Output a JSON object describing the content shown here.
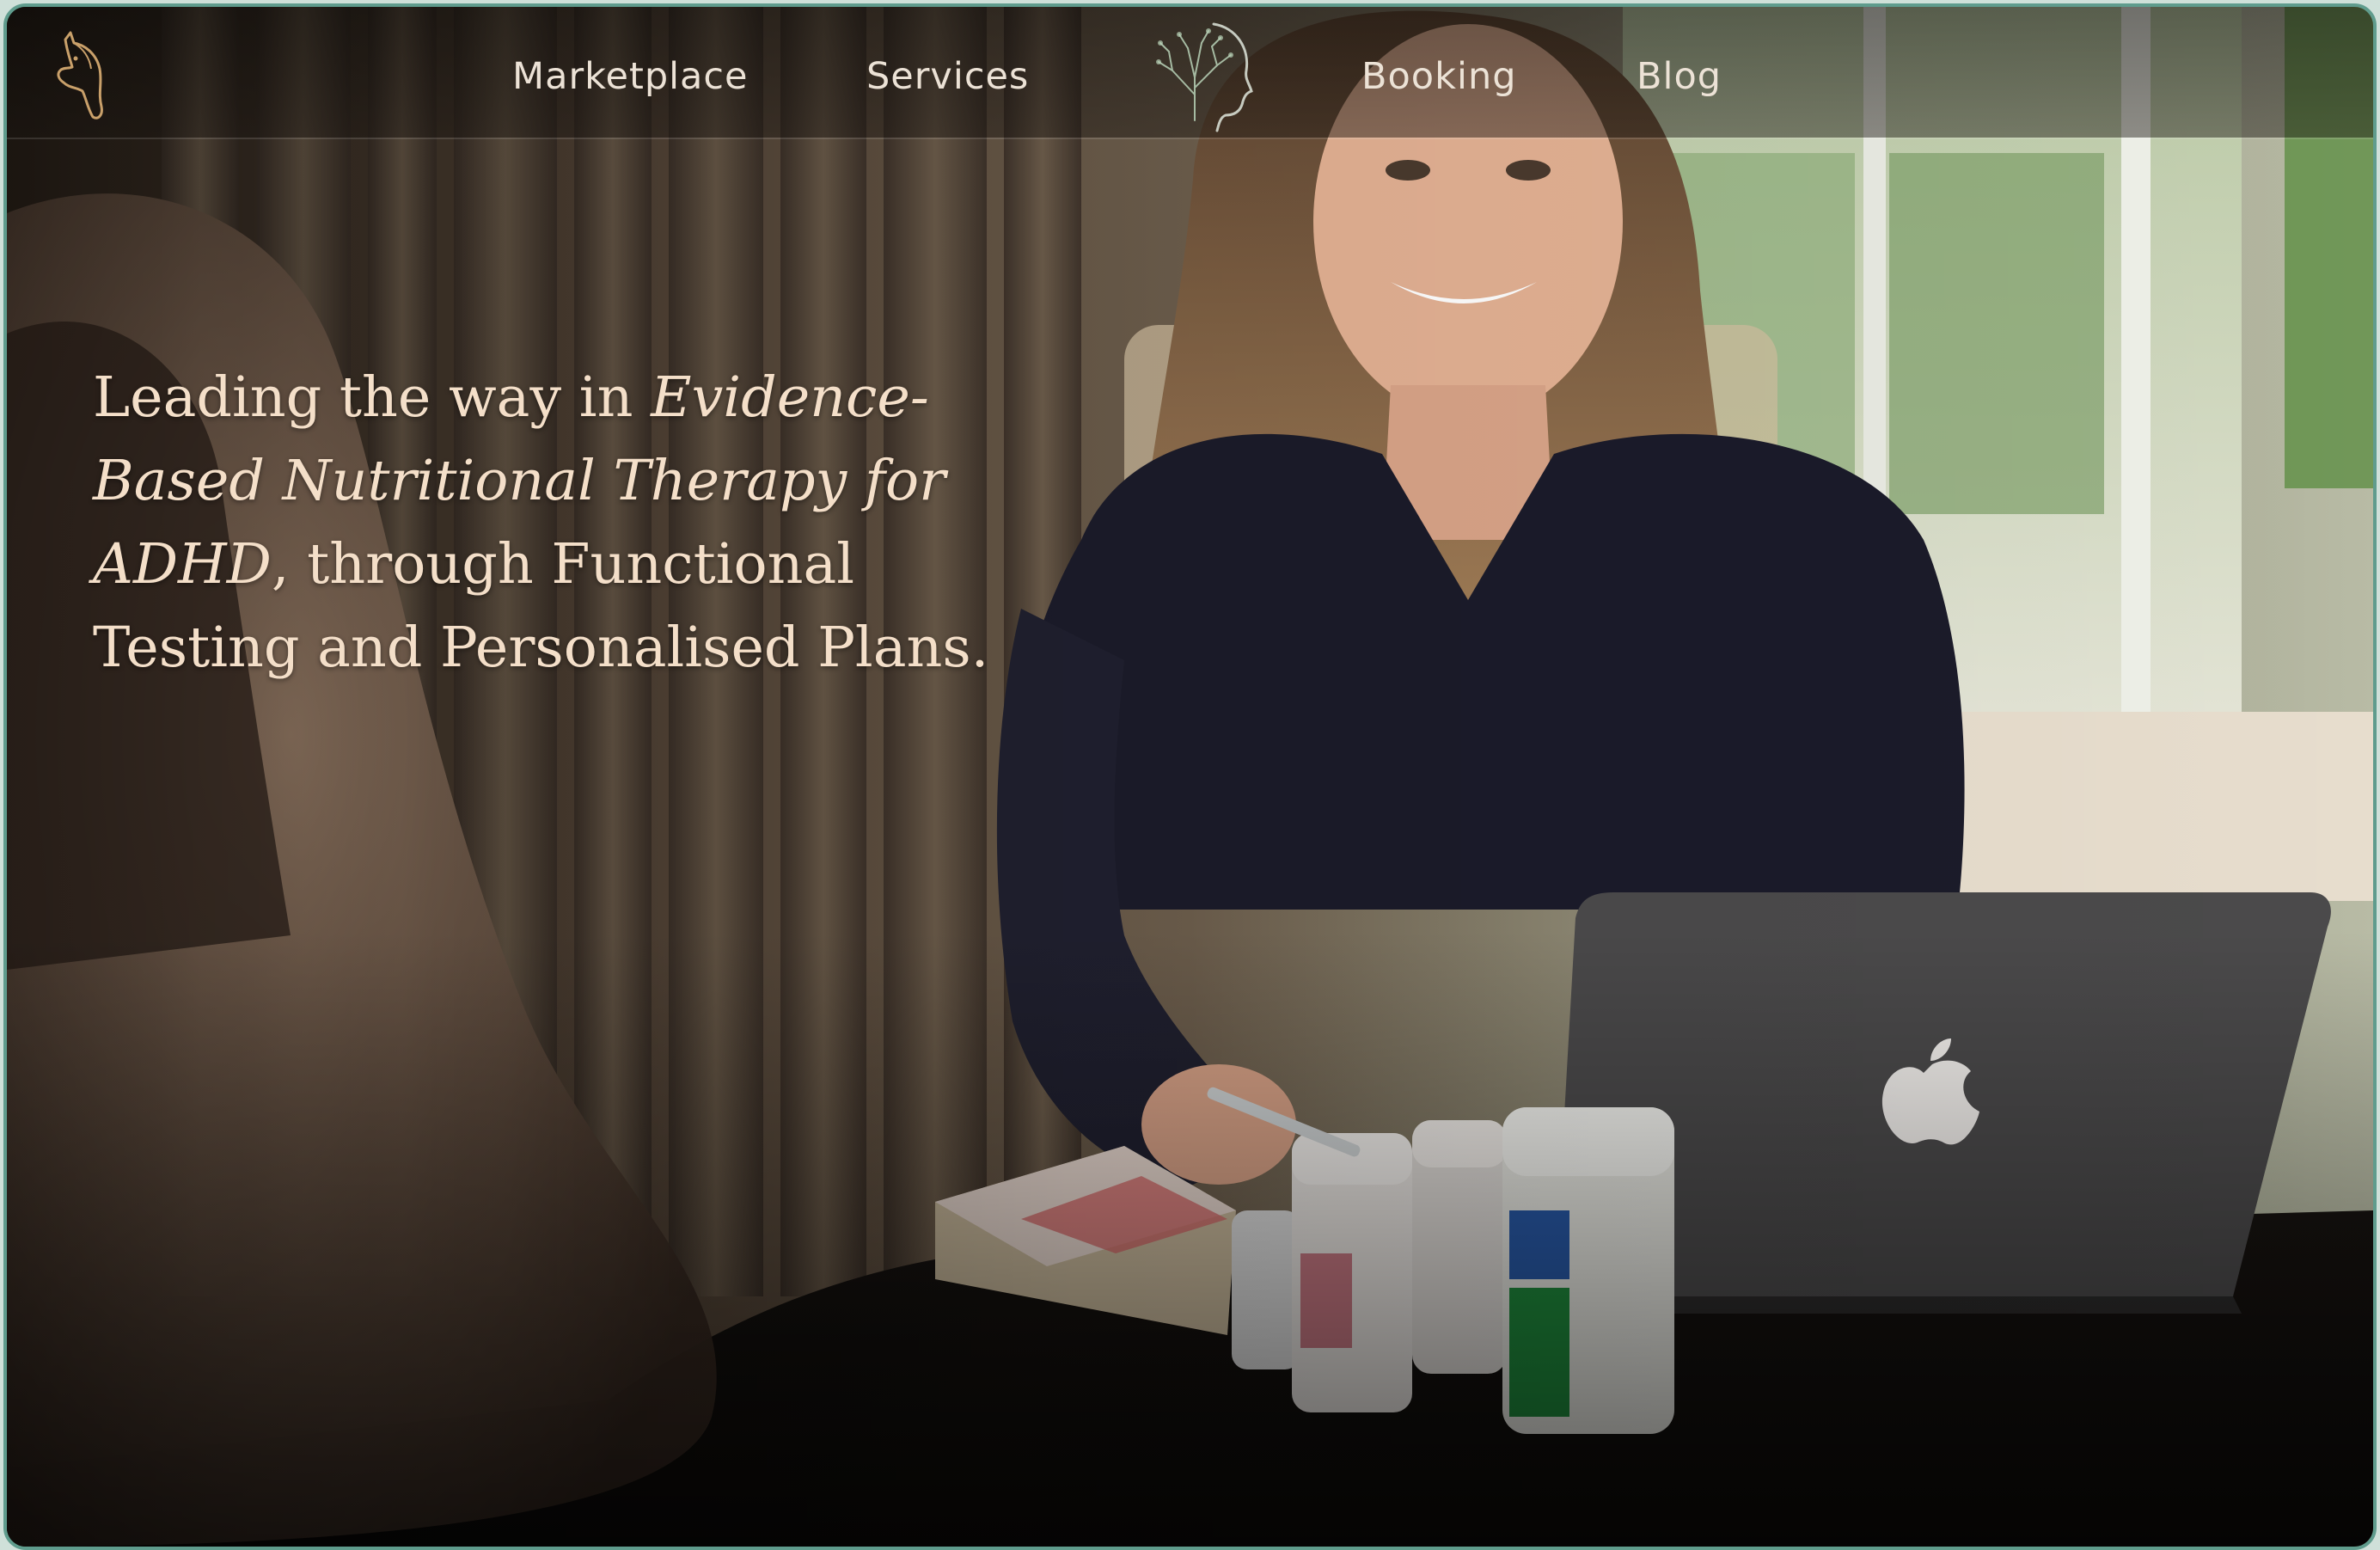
{
  "nav": {
    "links": [
      {
        "label": "Marketplace"
      },
      {
        "label": "Services"
      },
      {
        "label": "Booking"
      },
      {
        "label": "Blog"
      }
    ],
    "logo_icon": "horse-head-icon",
    "center_icon": "tree-head-silhouette-icon"
  },
  "hero": {
    "part1": "Leading the way in ",
    "emphasis1": "Evidence-Based Nutritional Therapy for ADHD",
    "part2": ", through Functional Testing and Personalised Plans."
  },
  "colors": {
    "border": "#5f9c8d",
    "headline": "#f4dfc9",
    "nav_text": "#ece2d6"
  }
}
